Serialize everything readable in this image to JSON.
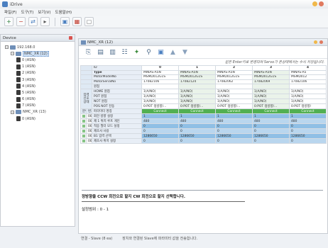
{
  "app": {
    "title": "iDrive"
  },
  "menu": [
    "파일(F)",
    "도구(T)",
    "보기(V)",
    "도움말(H)"
  ],
  "toolbar_icons": [
    "add-icon",
    "remove-icon",
    "connect-icon",
    "play-icon",
    "save-icon",
    "settings-icon",
    "window-icon"
  ],
  "left_panel": {
    "title": "Device",
    "tree": [
      {
        "label": "192.168.0",
        "level": 0,
        "type": "network"
      },
      {
        "label": "NMC_XR (12)",
        "level": 1,
        "type": "network",
        "selected": true
      },
      {
        "label": "0 (ASN)",
        "level": 2,
        "type": "drive"
      },
      {
        "label": "1 (ASN)",
        "level": 2,
        "type": "drive"
      },
      {
        "label": "2 (ASN)",
        "level": 2,
        "type": "drive"
      },
      {
        "label": "3 (ASN)",
        "level": 2,
        "type": "drive"
      },
      {
        "label": "4 (ASN)",
        "level": 2,
        "type": "drive"
      },
      {
        "label": "5 (ASN)",
        "level": 2,
        "type": "drive"
      },
      {
        "label": "6 (ASN)",
        "level": 2,
        "type": "drive"
      },
      {
        "label": "7 (ASN)",
        "level": 2,
        "type": "drive"
      },
      {
        "label": "NMC_XR (13)",
        "level": 1,
        "type": "network"
      },
      {
        "label": "0 (ASN)",
        "level": 2,
        "type": "drive"
      }
    ]
  },
  "right_panel": {
    "tab_title": "NMC_XR (12)",
    "inner_toolbar_icons": [
      "save-icon",
      "grid-icon",
      "chart-icon",
      "parameter-icon",
      "tools-icon",
      "filter-icon",
      "info-icon",
      "up-icon",
      "down-icon"
    ],
    "hint": "같은 Enter키로 변경되며 Servo가 온상태에서는 수시 저장됩니다.",
    "table": {
      "id_label": "ID",
      "ids": [
        "0",
        "1",
        "2",
        "3",
        "4"
      ],
      "info_rows": [
        {
          "name": "Type",
          "values": [
            "MINAS-A5N",
            "MINAS-A5N",
            "MINAS-A5N",
            "MINAS-A5N",
            "MINAS-A5"
          ]
        },
        {
          "name": "MotorModelNo",
          "values": [
            "MSMD012G1S",
            "MSMD012G1S",
            "MSMD012G1S",
            "MSMD012G1S",
            "MSMD012"
          ]
        },
        {
          "name": "MotorSerialNo",
          "values": [
            "17082106",
            "17082124",
            "17082062",
            "17082069",
            "17082106"
          ]
        },
        {
          "name": "원점",
          "values": [
            "",
            "",
            "",
            "",
            ""
          ]
        }
      ],
      "io_group": "입력 신호 상태",
      "io_rows": [
        {
          "name": "HOME 원점",
          "values": [
            "1(A/NO)",
            "1(A/NO)",
            "1(A/NO)",
            "1(A/NO)",
            "1(A/NO)"
          ]
        },
        {
          "name": "POT 원점",
          "values": [
            "1(A/NO)",
            "1(A/NO)",
            "1(A/NO)",
            "1(A/NO)",
            "1(A/NO)"
          ]
        },
        {
          "name": "NOT 원점",
          "values": [
            "1(A/NO)",
            "1(A/NO)",
            "1(A/NO)",
            "1(A/NO)",
            "1(A/NO)"
          ]
        },
        {
          "name": "POS NOT 진동",
          "values": [
            "0:POT 정방향/...",
            "0:POT 정방향/...",
            "0:POT 정방향/...",
            "0:POT 정방향/...",
            "0:POT 정방향/"
          ]
        }
      ],
      "status_label": "Connect",
      "param_header": {
        "a": "분류",
        "b": "번호",
        "c": "파라미터 명칭"
      },
      "param_rows": [
        {
          "group": "00",
          "no": "000",
          "name": "회전 방향 설정",
          "values": [
            "1",
            "1",
            "1",
            "1",
            "1"
          ]
        },
        {
          "group": "01",
          "no": "001",
          "name": "제 1 위치 루프 게인",
          "values": [
            "480",
            "480",
            "480",
            "480",
            "480"
          ]
        },
        {
          "group": "02",
          "no": "002",
          "name": "적응 필터 모드 설정",
          "values": [
            "0",
            "0",
            "0",
            "0",
            "0"
          ]
        },
        {
          "group": "03",
          "no": "004",
          "name": "제조사 사용",
          "values": [
            "0",
            "0",
            "0",
            "0",
            "0"
          ]
        },
        {
          "group": "04",
          "no": "005",
          "name": "B1 입력 선택",
          "values": [
            "1286650",
            "1286650",
            "1286650",
            "1286650",
            "1286650"
          ]
        },
        {
          "group": "05",
          "no": "006",
          "name": "제조사 위치 설정",
          "values": [
            "0",
            "0",
            "0",
            "0",
            "0"
          ]
        }
      ]
    },
    "description": {
      "title": "정방향을 CCW 회전으로 할지 CW 회전으로 할지 선택합니다.",
      "range": "설정범위 : 0 - 1"
    }
  },
  "statusbar": {
    "left": "연결 - Slave (8 ea)",
    "right": "장치와 연결된 Slave에 파라미터 값을 전송합니다."
  },
  "colors": {
    "accent": "#4a7fc0",
    "connect": "#52b052",
    "param_cell": "#8fbfe5"
  }
}
